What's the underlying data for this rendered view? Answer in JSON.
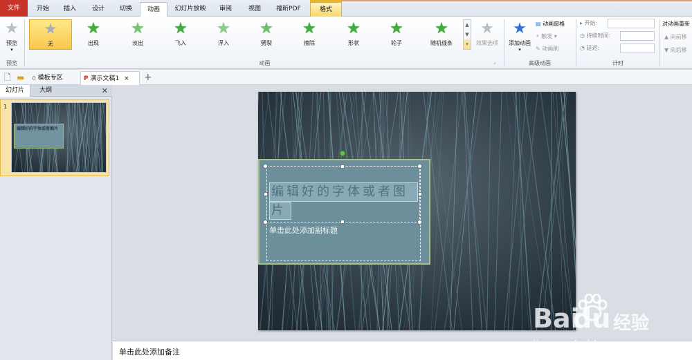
{
  "tabs": [
    {
      "label": "文件"
    },
    {
      "label": "开始"
    },
    {
      "label": "插入"
    },
    {
      "label": "设计"
    },
    {
      "label": "切换"
    },
    {
      "label": "动画"
    },
    {
      "label": "幻灯片放映"
    },
    {
      "label": "审阅"
    },
    {
      "label": "视图"
    },
    {
      "label": "福昕PDF"
    },
    {
      "label": "格式"
    }
  ],
  "ribbon": {
    "preview": {
      "label": "预览",
      "group": "预览"
    },
    "animations": [
      {
        "label": "无"
      },
      {
        "label": "出现"
      },
      {
        "label": "淡出"
      },
      {
        "label": "飞入"
      },
      {
        "label": "浮入"
      },
      {
        "label": "劈裂"
      },
      {
        "label": "擦除"
      },
      {
        "label": "形状"
      },
      {
        "label": "轮子"
      },
      {
        "label": "随机线条"
      }
    ],
    "effect_options": "效果选项",
    "anim_group": "动画",
    "advanced": {
      "add": "添加动画",
      "pane": "动画窗格",
      "trigger": "触发",
      "painter": "动画刷",
      "group": "高级动画"
    },
    "timing": {
      "start": "开始:",
      "duration": "持续时间:",
      "delay": "延迟:",
      "group": "计时",
      "reorder": "对动画重新",
      "fwd": "向前移",
      "back": "向后移"
    }
  },
  "docbar": {
    "templates": "模板专区",
    "doc": "演示文稿1"
  },
  "left": {
    "tab_slides": "幻灯片",
    "tab_outline": "大纲",
    "num": "1",
    "thumb_title": "编辑好的字体或者图片"
  },
  "slide": {
    "title_line1": "编辑好的字体或者图",
    "title_line2": "片",
    "subtitle": "单击此处添加副标题"
  },
  "notes": "单击此处添加备注",
  "watermark": {
    "brand": "Bai",
    "brand2": "du",
    "cn": "经验",
    "url": "jingyan.baidu.com"
  }
}
